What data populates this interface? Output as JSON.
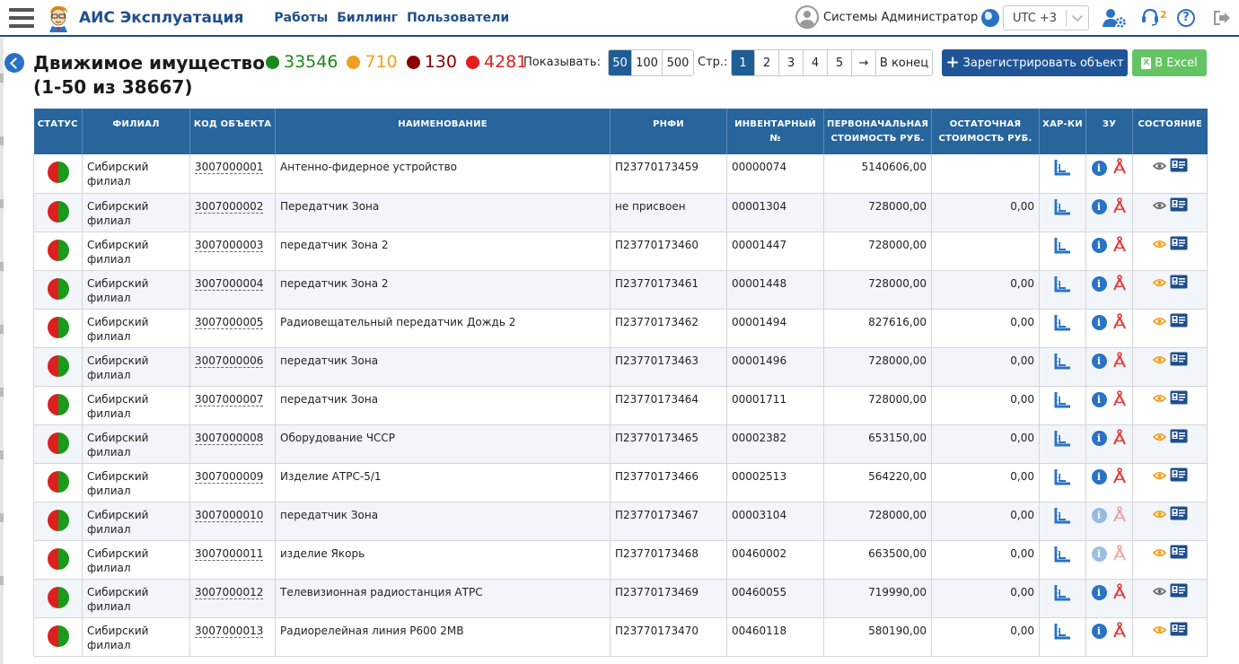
{
  "app": {
    "title": "АИС Эксплуатация",
    "nav": [
      "Работы",
      "Биллинг",
      "Пользователи"
    ],
    "user": "Системы Администратор",
    "timezone": "UTC +3",
    "support_count": "2"
  },
  "page": {
    "title_line1": "Движимое имущество",
    "title_line2": "(1-50 из 38667)",
    "counters": [
      {
        "value": "33546",
        "color": "#1a8a1a"
      },
      {
        "value": "710",
        "color": "#f0a020"
      },
      {
        "value": "130",
        "color": "#8b0000"
      },
      {
        "value": "4281",
        "color": "#e61e1e"
      }
    ],
    "show_label": "Показывать:",
    "page_sizes": [
      "50",
      "100",
      "500"
    ],
    "pages_label": "Стр.:",
    "pages": [
      "1",
      "2",
      "3",
      "4",
      "5",
      "→",
      "В конец"
    ],
    "register_button": "Зарегистрировать объект",
    "excel_button": "В Excel"
  },
  "table": {
    "columns": [
      "Статус",
      "Филиал",
      "Код объекта",
      "Наименование",
      "РНФИ",
      "Инвентарный №",
      "Первоначальная стоимость руб.",
      "Остаточная стоимость руб.",
      "Хар-ки",
      "ЗУ",
      "Состояние"
    ],
    "rows": [
      {
        "branch": "Сибирский филиал",
        "code": "3007000001",
        "name": "Антенно-фидерное устройство",
        "rnfi": "П23770173459",
        "inv": "00000074",
        "initial": "5140606,00",
        "residual": "",
        "zu_faded": false,
        "eye": "gray"
      },
      {
        "branch": "Сибирский филиал",
        "code": "3007000002",
        "name": "Передатчик Зона",
        "rnfi": "не присвоен",
        "inv": "00001304",
        "initial": "728000,00",
        "residual": "0,00",
        "zu_faded": false,
        "eye": "gray"
      },
      {
        "branch": "Сибирский филиал",
        "code": "3007000003",
        "name": "передатчик Зона 2",
        "rnfi": "П23770173460",
        "inv": "00001447",
        "initial": "728000,00",
        "residual": "",
        "zu_faded": false,
        "eye": "orange"
      },
      {
        "branch": "Сибирский филиал",
        "code": "3007000004",
        "name": "передатчик Зона 2",
        "rnfi": "П23770173461",
        "inv": "00001448",
        "initial": "728000,00",
        "residual": "0,00",
        "zu_faded": false,
        "eye": "orange"
      },
      {
        "branch": "Сибирский филиал",
        "code": "3007000005",
        "name": "Радиовещательный передатчик Дождь 2",
        "rnfi": "П23770173462",
        "inv": "00001494",
        "initial": "827616,00",
        "residual": "0,00",
        "zu_faded": false,
        "eye": "orange"
      },
      {
        "branch": "Сибирский филиал",
        "code": "3007000006",
        "name": "передатчик Зона",
        "rnfi": "П23770173463",
        "inv": "00001496",
        "initial": "728000,00",
        "residual": "0,00",
        "zu_faded": false,
        "eye": "orange"
      },
      {
        "branch": "Сибирский филиал",
        "code": "3007000007",
        "name": "передатчик Зона",
        "rnfi": "П23770173464",
        "inv": "00001711",
        "initial": "728000,00",
        "residual": "0,00",
        "zu_faded": false,
        "eye": "orange"
      },
      {
        "branch": "Сибирский филиал",
        "code": "3007000008",
        "name": "Оборудование ЧССР",
        "rnfi": "П23770173465",
        "inv": "00002382",
        "initial": "653150,00",
        "residual": "0,00",
        "zu_faded": false,
        "eye": "orange"
      },
      {
        "branch": "Сибирский филиал",
        "code": "3007000009",
        "name": "Изделие АТРС-5/1",
        "rnfi": "П23770173466",
        "inv": "00002513",
        "initial": "564220,00",
        "residual": "0,00",
        "zu_faded": false,
        "eye": "orange"
      },
      {
        "branch": "Сибирский филиал",
        "code": "3007000010",
        "name": "передатчик Зона",
        "rnfi": "П23770173467",
        "inv": "00003104",
        "initial": "728000,00",
        "residual": "0,00",
        "zu_faded": true,
        "eye": "orange"
      },
      {
        "branch": "Сибирский филиал",
        "code": "3007000011",
        "name": "изделие Якорь",
        "rnfi": "П23770173468",
        "inv": "00460002",
        "initial": "663500,00",
        "residual": "0,00",
        "zu_faded": true,
        "eye": "orange"
      },
      {
        "branch": "Сибирский филиал",
        "code": "3007000012",
        "name": "Телевизионная радиостанция АТРС",
        "rnfi": "П23770173469",
        "inv": "00460055",
        "initial": "719990,00",
        "residual": "0,00",
        "zu_faded": false,
        "eye": "gray"
      },
      {
        "branch": "Сибирский филиал",
        "code": "3007000013",
        "name": "Радиорелейная линия Р600 2МВ",
        "rnfi": "П23770173470",
        "inv": "00460118",
        "initial": "580190,00",
        "residual": "0,00",
        "zu_faded": false,
        "eye": "orange"
      }
    ]
  }
}
